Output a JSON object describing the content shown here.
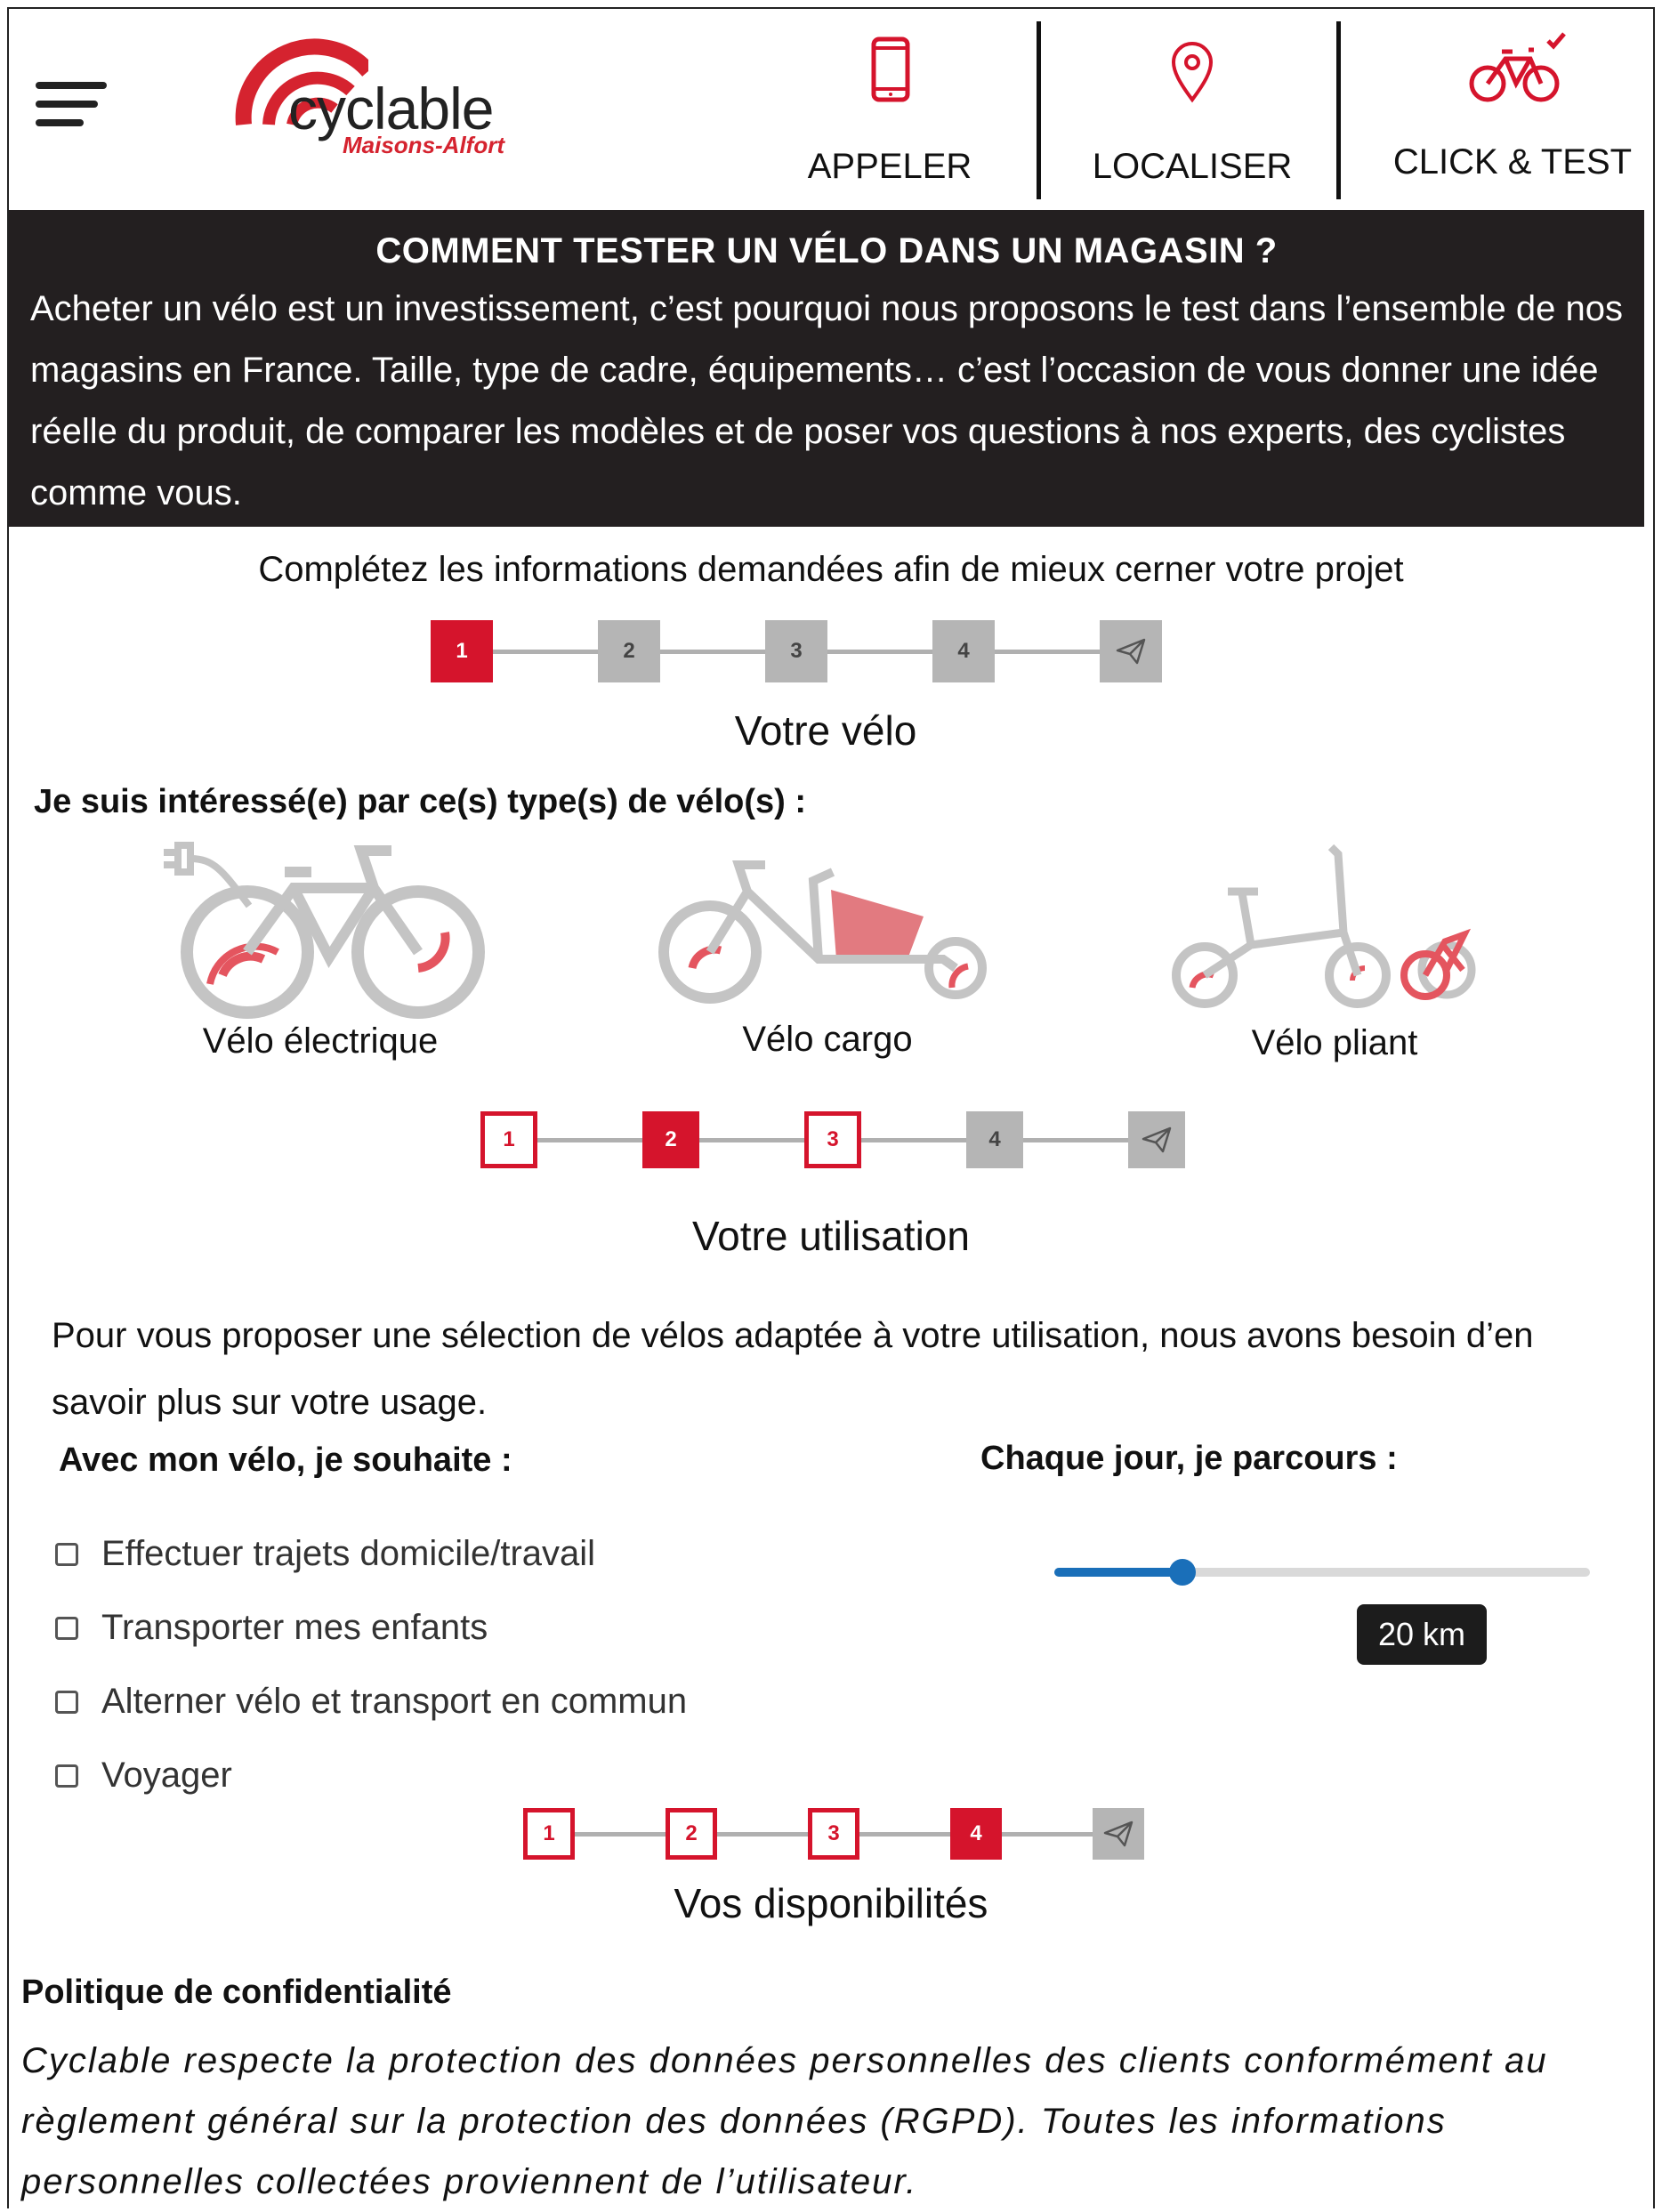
{
  "header": {
    "logo": {
      "word": "cyclable",
      "sub": "Maisons-Alfort"
    },
    "buttons": [
      {
        "label": "APPELER",
        "icon": "phone-icon"
      },
      {
        "label": "LOCALISER",
        "icon": "map-pin-icon"
      },
      {
        "label": "CLICK & TEST",
        "icon": "bike-check-icon"
      }
    ]
  },
  "intro": {
    "title": "COMMENT TESTER UN VÉLO DANS UN MAGASIN ?",
    "body": "Acheter un vélo est un investissement, c’est pourquoi nous proposons le test dans l’ensemble de nos magasins en France. Taille, type de cadre, équipements… c’est l’occasion de vous donner une idée réelle du produit, de comparer les modèles et de poser vos questions à nos experts, des cyclistes comme vous."
  },
  "form_intro": "Complétez les informations demandées afin de mieux cerner votre projet",
  "steppers": [
    {
      "steps": [
        "1",
        "2",
        "3",
        "4"
      ],
      "states": [
        "active",
        "todo",
        "todo",
        "todo",
        "todo"
      ],
      "title": "Votre vélo"
    },
    {
      "steps": [
        "1",
        "2",
        "3",
        "4"
      ],
      "states": [
        "done",
        "active",
        "done",
        "todo",
        "todo"
      ],
      "title": "Votre utilisation"
    },
    {
      "steps": [
        "1",
        "2",
        "3",
        "4"
      ],
      "states": [
        "done",
        "done",
        "done",
        "active",
        "todo"
      ],
      "title": "Vos disponibilités"
    }
  ],
  "bike_section": {
    "question": "Je suis intéressé(e) par ce(s) type(s) de vélo(s) :",
    "bikes": [
      {
        "label": "Vélo électrique",
        "icon": "electric-bike-icon"
      },
      {
        "label": "Vélo cargo",
        "icon": "cargo-bike-icon"
      },
      {
        "label": "Vélo pliant",
        "icon": "folding-bike-icon"
      }
    ]
  },
  "usage_section": {
    "text": "Pour vous proposer une sélection de vélos adaptée à votre utilisation, nous avons besoin d’en savoir plus sur votre usage.",
    "wish_title": "Avec mon vélo, je souhaite :",
    "options": [
      {
        "label": "Effectuer trajets domicile/travail",
        "checked": false
      },
      {
        "label": "Transporter mes enfants",
        "checked": false
      },
      {
        "label": "Alterner vélo et transport en commun",
        "checked": false
      },
      {
        "label": "Voyager",
        "checked": false
      }
    ],
    "distance_title": "Chaque jour, je parcours :",
    "distance": {
      "value_label": "20 km",
      "position_fraction": 0.24
    }
  },
  "privacy": {
    "title": "Politique de confidentialité",
    "text": "Cyclable respecte la protection des données personnelles des clients conformément au règlement général sur la protection des données (RGPD). Toutes les informations personnelles collectées proviennent de l’utilisateur."
  },
  "colors": {
    "brand_red": "#d5142c",
    "dark_bg": "#231f20",
    "slider_blue": "#1a6fb9",
    "step_grey": "#b5b5b5"
  }
}
